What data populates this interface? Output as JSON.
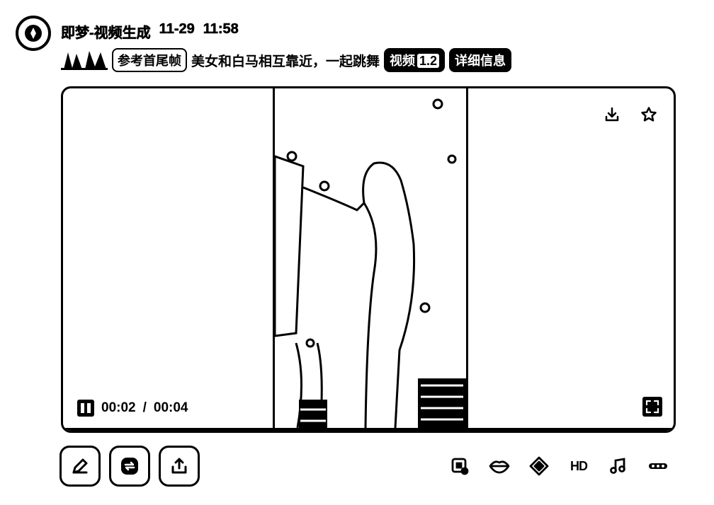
{
  "header": {
    "app_name": "即梦-视频生成",
    "date": "11-29",
    "time": "11:58"
  },
  "meta": {
    "reference_chip": "参考首尾帧",
    "prompt": "美女和白马相互靠近，一起跳舞",
    "model_chip_label": "视频",
    "model_chip_version": "1.2",
    "details_chip": "详细信息"
  },
  "player": {
    "current_time": "00:02",
    "separator": "/",
    "duration": "00:04",
    "progress": 0.5
  },
  "icons": {
    "app": "compass-icon",
    "download": "download-icon",
    "favorite": "star-icon",
    "pause": "pause-icon",
    "fullscreen": "fullscreen-icon",
    "edit": "pencil-icon",
    "regenerate": "regenerate-icon",
    "share": "upload-icon",
    "lipsync": "lips-icon",
    "extend": "diamond-icon",
    "hd": "hd-icon",
    "music": "music-icon",
    "more": "more-icon",
    "frame": "frame-icon"
  },
  "actions_right": {
    "hd_label": "HD"
  }
}
